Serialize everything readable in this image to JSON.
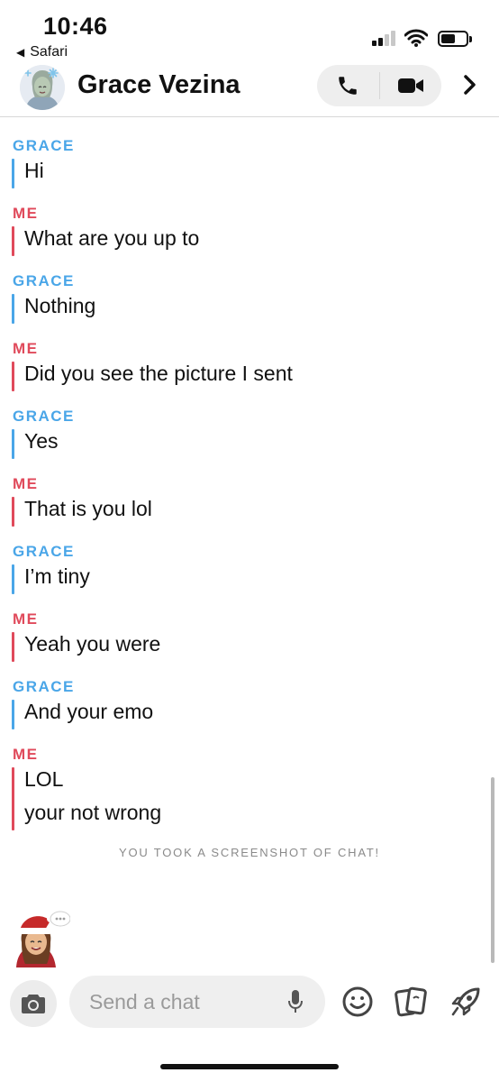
{
  "status_bar": {
    "time": "10:46",
    "back_app": "Safari"
  },
  "header": {
    "contact_name": "Grace Vezina",
    "icons": [
      "phone-icon",
      "video-icon",
      "chevron-right-icon"
    ]
  },
  "messages": [
    {
      "sender": "GRACE",
      "kind": "grace",
      "lines": [
        "Hi"
      ]
    },
    {
      "sender": "ME",
      "kind": "me",
      "lines": [
        "What are you up to"
      ]
    },
    {
      "sender": "GRACE",
      "kind": "grace",
      "lines": [
        "Nothing"
      ]
    },
    {
      "sender": "ME",
      "kind": "me",
      "lines": [
        "Did you see the picture I sent"
      ]
    },
    {
      "sender": "GRACE",
      "kind": "grace",
      "lines": [
        "Yes"
      ]
    },
    {
      "sender": "ME",
      "kind": "me",
      "lines": [
        "That is you lol"
      ]
    },
    {
      "sender": "GRACE",
      "kind": "grace",
      "lines": [
        "I’m tiny"
      ]
    },
    {
      "sender": "ME",
      "kind": "me",
      "lines": [
        "Yeah you were"
      ]
    },
    {
      "sender": "GRACE",
      "kind": "grace",
      "lines": [
        "And your emo"
      ]
    },
    {
      "sender": "ME",
      "kind": "me",
      "lines": [
        "LOL",
        "your not wrong"
      ]
    }
  ],
  "screenshot_notice": "YOU TOOK A SCREENSHOT OF CHAT!",
  "composer": {
    "placeholder": "Send a chat",
    "icons": [
      "camera-icon",
      "microphone-icon",
      "smiley-icon",
      "stickers-icon",
      "rocket-icon"
    ]
  },
  "colors": {
    "grace": "#4aa6e8",
    "me": "#e04a5b",
    "notice": "#8a8a8a"
  }
}
